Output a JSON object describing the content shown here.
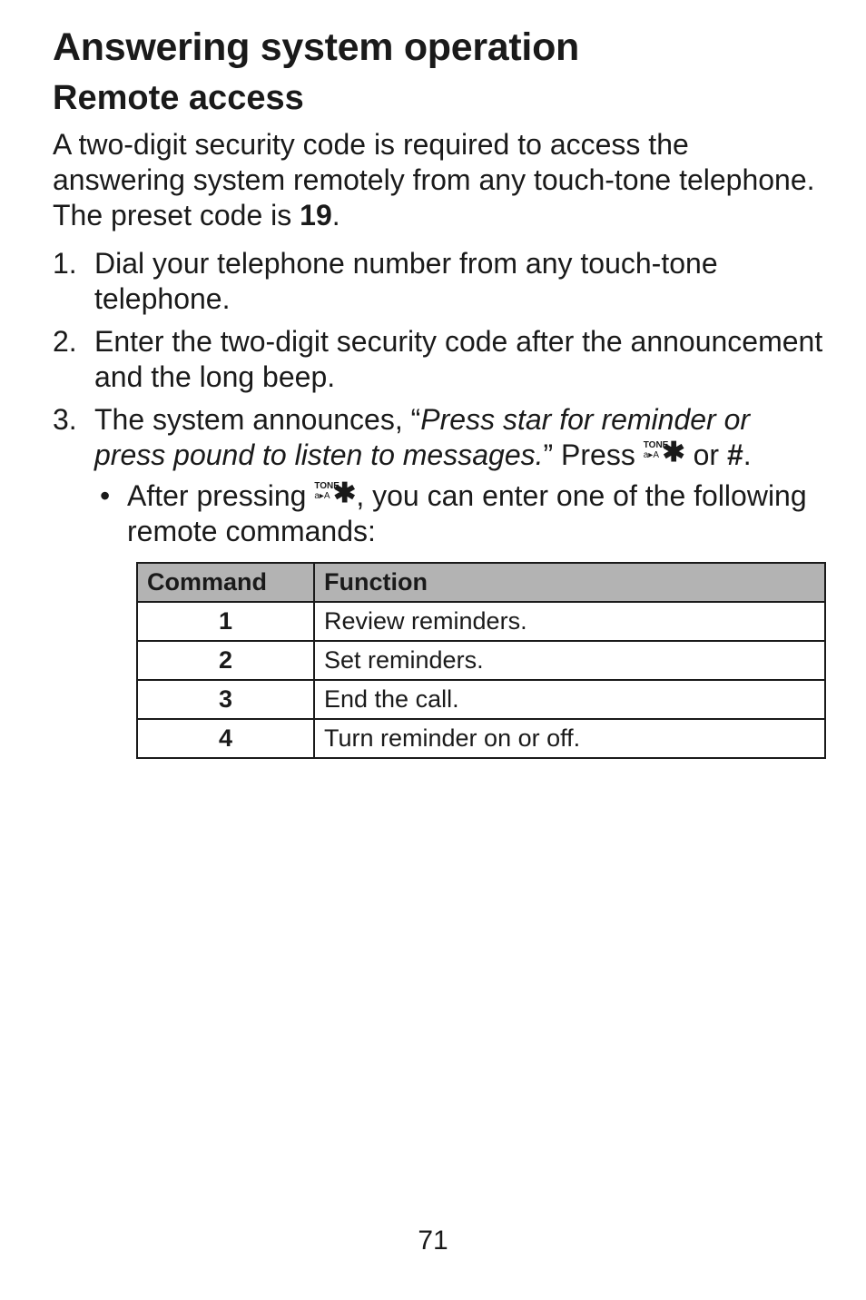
{
  "heading": "Answering system operation",
  "subheading": "Remote access",
  "intro_a": "A two-digit security code is required to access the answering system remotely from any touch-tone telephone. The preset code is ",
  "intro_code": "19",
  "intro_b": ".",
  "steps": {
    "s1": "Dial your telephone number from any touch-tone telephone.",
    "s2": "Enter the two-digit security code after the announcement and the long beep.",
    "s3a": "The system announces, “",
    "s3i": "Press star for reminder or press pound to listen to messages.",
    "s3b": "” Press ",
    "s3c": " or ",
    "s3hash": "#",
    "s3d": "."
  },
  "bullet_a": "After pressing ",
  "bullet_b": ", you can enter one of the following remote commands:",
  "tonestar": {
    "tone": "TONE",
    "sub": "a▸A",
    "star": "✱"
  },
  "table": {
    "hcmd": "Command",
    "hfn": "Function",
    "rows": [
      {
        "cmd": "1",
        "fn": "Review reminders."
      },
      {
        "cmd": "2",
        "fn": "Set reminders."
      },
      {
        "cmd": "3",
        "fn": "End the call."
      },
      {
        "cmd": "4",
        "fn": "Turn reminder on or off."
      }
    ]
  },
  "pagenum": "71"
}
